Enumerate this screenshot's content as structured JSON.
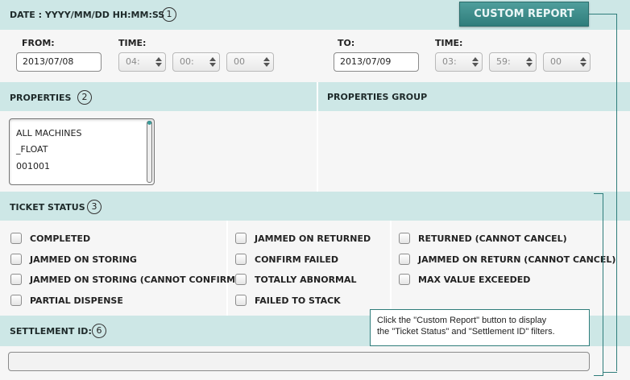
{
  "date_section": {
    "title": "DATE : YYYY/MM/DD HH:MM:SS",
    "number": "1",
    "from_label": "FROM:",
    "from_date": "2013/07/08",
    "from_time_label": "TIME:",
    "from_hour": "04:",
    "from_minute": "00:",
    "from_second": "00",
    "to_label": "TO:",
    "to_date": "2013/07/09",
    "to_time_label": "TIME:",
    "to_hour": "03:",
    "to_minute": "59:",
    "to_second": "00"
  },
  "custom_report_button": "CUSTOM REPORT",
  "properties": {
    "title": "PROPERTIES",
    "number": "2",
    "items": [
      "ALL MACHINES",
      "_FLOAT",
      "001001"
    ],
    "group_title": "PROPERTIES GROUP"
  },
  "ticket_status": {
    "title": "TICKET STATUS",
    "number": "3",
    "col1": [
      "COMPLETED",
      "JAMMED ON STORING",
      "JAMMED ON STORING (CANNOT CONFIRM)",
      "PARTIAL DISPENSE"
    ],
    "col2": [
      "JAMMED ON RETURNED",
      "CONFIRM FAILED",
      "TOTALLY ABNORMAL",
      "FAILED TO STACK"
    ],
    "col3": [
      "RETURNED (CANNOT CANCEL)",
      "JAMMED ON RETURN (CANNOT CANCEL)",
      "MAX VALUE EXCEEDED"
    ]
  },
  "settlement": {
    "title": "SETTLEMENT ID:",
    "number": "6",
    "value": ""
  },
  "tooltip": {
    "line1": "Click the \"Custom Report\" button to display",
    "line2": "the \"Ticket Status\" and \"Settlement ID\" filters."
  },
  "colors": {
    "header_band": "#cde7e6",
    "panel": "#f6f6f6",
    "accent": "#2f7d7b"
  }
}
